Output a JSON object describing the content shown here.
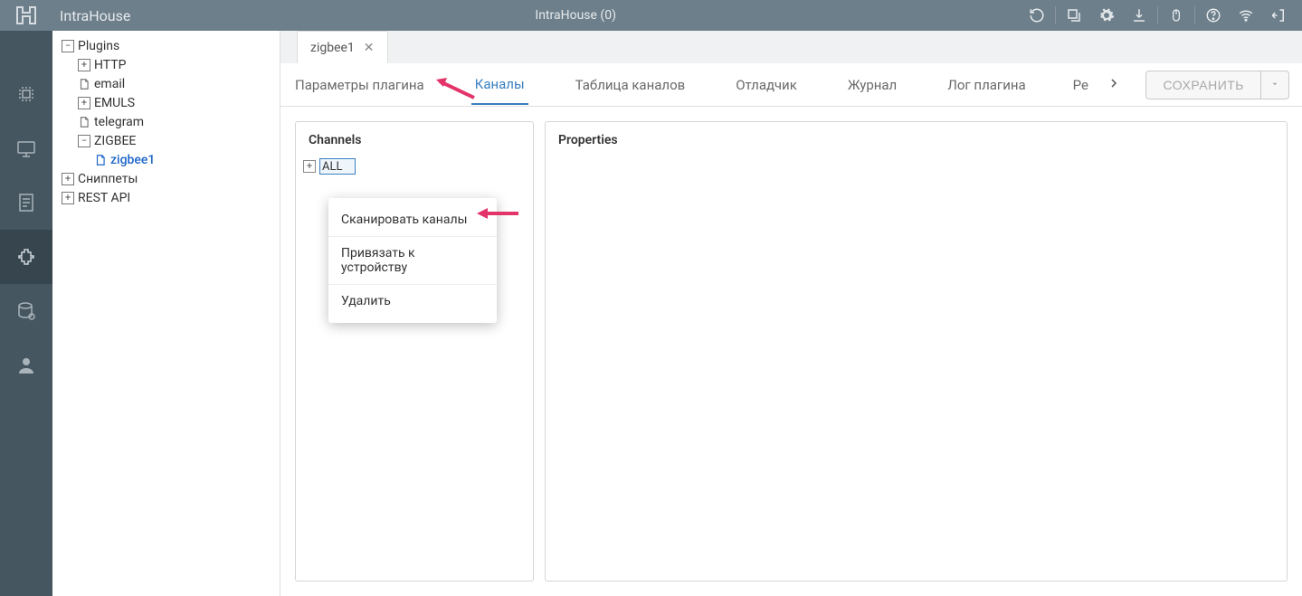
{
  "topbar": {
    "app_title": "IntraHouse",
    "center_title": "IntraHouse (0)"
  },
  "tree": {
    "root": "Plugins",
    "items": [
      {
        "label": "HTTP",
        "icon": "plus"
      },
      {
        "label": "email",
        "icon": "file"
      },
      {
        "label": "EMULS",
        "icon": "plus"
      },
      {
        "label": "telegram",
        "icon": "file"
      },
      {
        "label": "ZIGBEE",
        "icon": "minus"
      },
      {
        "label": "zigbee1",
        "icon": "file",
        "selected": true,
        "child_of_zigbee": true
      }
    ],
    "snippets": "Сниппеты",
    "restapi": "REST API"
  },
  "tab": {
    "label": "zigbee1"
  },
  "subtabs": {
    "items": [
      "Параметры плагина",
      "Каналы",
      "Таблица каналов",
      "Отладчик",
      "Журнал",
      "Лог плагина"
    ],
    "partial": "Ре",
    "active_index": 1,
    "save_label": "СОХРАНИТЬ"
  },
  "panels": {
    "channels_title": "Channels",
    "channels_root": "ALL",
    "properties_title": "Properties"
  },
  "context_menu": {
    "items": [
      "Сканировать каналы",
      "Привязать к устройству",
      "Удалить"
    ]
  }
}
